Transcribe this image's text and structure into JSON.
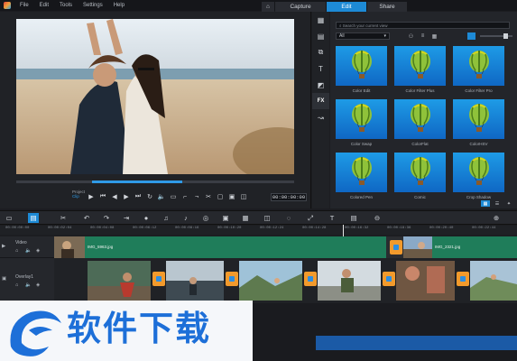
{
  "menu": {
    "file": "File",
    "edit": "Edit",
    "tools": "Tools",
    "settings": "Settings",
    "help": "Help"
  },
  "workspace_tabs": {
    "capture": "Capture",
    "edit": "Edit",
    "share": "Share"
  },
  "player": {
    "project_label": "Project",
    "clip_label": "Clip",
    "timecode": "00:00:00:00",
    "scrub_position": 0.27
  },
  "library": {
    "search_placeholder": "Search your current view",
    "filter": "All",
    "filters": [
      {
        "label": "Color Edit"
      },
      {
        "label": "Color Filter Plus"
      },
      {
        "label": "Color Filter Pro"
      },
      {
        "label": "Color Swap"
      },
      {
        "label": "ColorFlat"
      },
      {
        "label": "ColorHSV"
      },
      {
        "label": "Colored Pen"
      },
      {
        "label": "Comic"
      },
      {
        "label": "Crop Shadow"
      }
    ]
  },
  "timeline": {
    "ruler": [
      "00:00:00:00",
      "00:00:02:04",
      "00:00:04:08",
      "00:00:06:12",
      "00:00:08:16",
      "00:00:10:20",
      "00:00:12:24",
      "00:00:14:28",
      "00:00:16:32",
      "00:00:18:36",
      "00:00:20:40",
      "00:00:22:44"
    ],
    "video_track": {
      "name": "Video",
      "clip1": "IMG_5963.jpg",
      "clip2": "IMG_2321.jpg"
    },
    "overlay_track": {
      "name": "Overlay1"
    }
  },
  "watermark": {
    "text": "软件下载"
  },
  "colors": {
    "accent": "#1d8ad6",
    "clip_green": "#1f7d5a",
    "transition_orange": "#f29a2c"
  }
}
